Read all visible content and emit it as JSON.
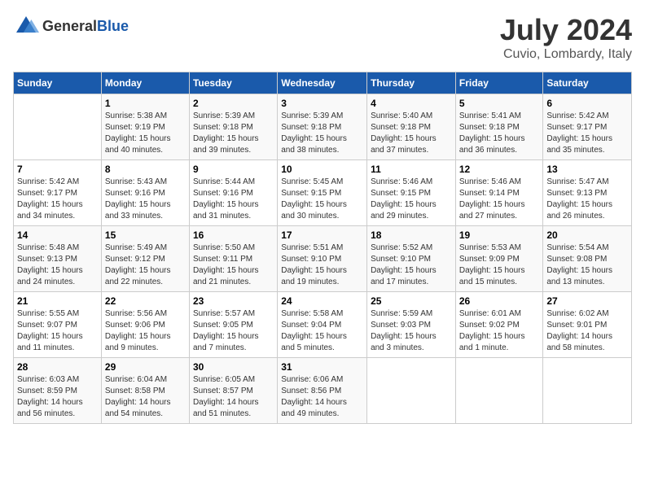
{
  "header": {
    "logo_general": "General",
    "logo_blue": "Blue",
    "month": "July 2024",
    "location": "Cuvio, Lombardy, Italy"
  },
  "columns": [
    "Sunday",
    "Monday",
    "Tuesday",
    "Wednesday",
    "Thursday",
    "Friday",
    "Saturday"
  ],
  "weeks": [
    [
      {
        "day": "",
        "info": ""
      },
      {
        "day": "1",
        "info": "Sunrise: 5:38 AM\nSunset: 9:19 PM\nDaylight: 15 hours\nand 40 minutes."
      },
      {
        "day": "2",
        "info": "Sunrise: 5:39 AM\nSunset: 9:18 PM\nDaylight: 15 hours\nand 39 minutes."
      },
      {
        "day": "3",
        "info": "Sunrise: 5:39 AM\nSunset: 9:18 PM\nDaylight: 15 hours\nand 38 minutes."
      },
      {
        "day": "4",
        "info": "Sunrise: 5:40 AM\nSunset: 9:18 PM\nDaylight: 15 hours\nand 37 minutes."
      },
      {
        "day": "5",
        "info": "Sunrise: 5:41 AM\nSunset: 9:18 PM\nDaylight: 15 hours\nand 36 minutes."
      },
      {
        "day": "6",
        "info": "Sunrise: 5:42 AM\nSunset: 9:17 PM\nDaylight: 15 hours\nand 35 minutes."
      }
    ],
    [
      {
        "day": "7",
        "info": "Sunrise: 5:42 AM\nSunset: 9:17 PM\nDaylight: 15 hours\nand 34 minutes."
      },
      {
        "day": "8",
        "info": "Sunrise: 5:43 AM\nSunset: 9:16 PM\nDaylight: 15 hours\nand 33 minutes."
      },
      {
        "day": "9",
        "info": "Sunrise: 5:44 AM\nSunset: 9:16 PM\nDaylight: 15 hours\nand 31 minutes."
      },
      {
        "day": "10",
        "info": "Sunrise: 5:45 AM\nSunset: 9:15 PM\nDaylight: 15 hours\nand 30 minutes."
      },
      {
        "day": "11",
        "info": "Sunrise: 5:46 AM\nSunset: 9:15 PM\nDaylight: 15 hours\nand 29 minutes."
      },
      {
        "day": "12",
        "info": "Sunrise: 5:46 AM\nSunset: 9:14 PM\nDaylight: 15 hours\nand 27 minutes."
      },
      {
        "day": "13",
        "info": "Sunrise: 5:47 AM\nSunset: 9:13 PM\nDaylight: 15 hours\nand 26 minutes."
      }
    ],
    [
      {
        "day": "14",
        "info": "Sunrise: 5:48 AM\nSunset: 9:13 PM\nDaylight: 15 hours\nand 24 minutes."
      },
      {
        "day": "15",
        "info": "Sunrise: 5:49 AM\nSunset: 9:12 PM\nDaylight: 15 hours\nand 22 minutes."
      },
      {
        "day": "16",
        "info": "Sunrise: 5:50 AM\nSunset: 9:11 PM\nDaylight: 15 hours\nand 21 minutes."
      },
      {
        "day": "17",
        "info": "Sunrise: 5:51 AM\nSunset: 9:10 PM\nDaylight: 15 hours\nand 19 minutes."
      },
      {
        "day": "18",
        "info": "Sunrise: 5:52 AM\nSunset: 9:10 PM\nDaylight: 15 hours\nand 17 minutes."
      },
      {
        "day": "19",
        "info": "Sunrise: 5:53 AM\nSunset: 9:09 PM\nDaylight: 15 hours\nand 15 minutes."
      },
      {
        "day": "20",
        "info": "Sunrise: 5:54 AM\nSunset: 9:08 PM\nDaylight: 15 hours\nand 13 minutes."
      }
    ],
    [
      {
        "day": "21",
        "info": "Sunrise: 5:55 AM\nSunset: 9:07 PM\nDaylight: 15 hours\nand 11 minutes."
      },
      {
        "day": "22",
        "info": "Sunrise: 5:56 AM\nSunset: 9:06 PM\nDaylight: 15 hours\nand 9 minutes."
      },
      {
        "day": "23",
        "info": "Sunrise: 5:57 AM\nSunset: 9:05 PM\nDaylight: 15 hours\nand 7 minutes."
      },
      {
        "day": "24",
        "info": "Sunrise: 5:58 AM\nSunset: 9:04 PM\nDaylight: 15 hours\nand 5 minutes."
      },
      {
        "day": "25",
        "info": "Sunrise: 5:59 AM\nSunset: 9:03 PM\nDaylight: 15 hours\nand 3 minutes."
      },
      {
        "day": "26",
        "info": "Sunrise: 6:01 AM\nSunset: 9:02 PM\nDaylight: 15 hours\nand 1 minute."
      },
      {
        "day": "27",
        "info": "Sunrise: 6:02 AM\nSunset: 9:01 PM\nDaylight: 14 hours\nand 58 minutes."
      }
    ],
    [
      {
        "day": "28",
        "info": "Sunrise: 6:03 AM\nSunset: 8:59 PM\nDaylight: 14 hours\nand 56 minutes."
      },
      {
        "day": "29",
        "info": "Sunrise: 6:04 AM\nSunset: 8:58 PM\nDaylight: 14 hours\nand 54 minutes."
      },
      {
        "day": "30",
        "info": "Sunrise: 6:05 AM\nSunset: 8:57 PM\nDaylight: 14 hours\nand 51 minutes."
      },
      {
        "day": "31",
        "info": "Sunrise: 6:06 AM\nSunset: 8:56 PM\nDaylight: 14 hours\nand 49 minutes."
      },
      {
        "day": "",
        "info": ""
      },
      {
        "day": "",
        "info": ""
      },
      {
        "day": "",
        "info": ""
      }
    ]
  ]
}
